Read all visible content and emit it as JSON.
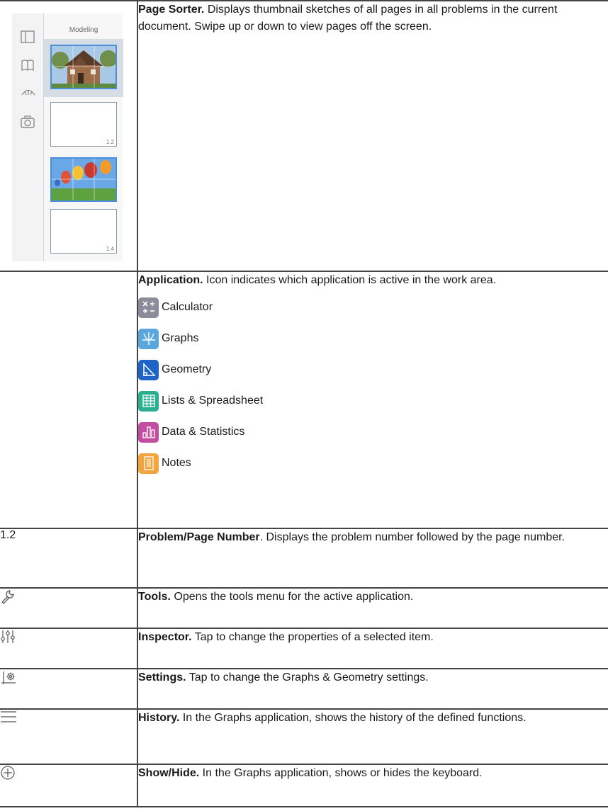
{
  "sorter": {
    "title": "Modeling",
    "thumbnails": [
      {
        "page": "",
        "content": "house"
      },
      {
        "page": "1.2",
        "content": "blank"
      },
      {
        "page": "",
        "content": "balloons"
      },
      {
        "page": "1.4",
        "content": "blank"
      }
    ],
    "side_icons": [
      "page-sorter-icon",
      "book-icon",
      "scale-icon",
      "camera-icon"
    ]
  },
  "rows": {
    "page_sorter": {
      "term": "Page Sorter.",
      "text": " Displays thumbnail sketches of all pages in all problems in the current document. Swipe up or down to view pages off the screen."
    },
    "application": {
      "term": "Application.",
      "text": " Icon indicates which application is active in the work area."
    },
    "problem_page": {
      "left": "1.2",
      "term": "Problem/Page Number",
      "text": ". Displays the problem number followed by the page number."
    },
    "tools": {
      "term": "Tools.",
      "text": " Opens the tools menu for the active application."
    },
    "inspector": {
      "term": "Inspector.",
      "text": " Tap to change the properties of a selected item."
    },
    "settings": {
      "term": "Settings.",
      "text": " Tap to change the Graphs & Geometry settings."
    },
    "history": {
      "term": "History.",
      "text": " In the Graphs application, shows the history of the defined functions."
    },
    "show_hide": {
      "term": "Show/Hide.",
      "text": " In the Graphs application, shows or hides the keyboard."
    }
  },
  "apps": [
    {
      "label": "Calculator",
      "icon": "calculator-icon",
      "color": "#8a8d99"
    },
    {
      "label": "Graphs",
      "icon": "graphs-icon",
      "color": "#5aa6dd"
    },
    {
      "label": "Geometry",
      "icon": "geometry-icon",
      "color": "#1e63c6"
    },
    {
      "label": "Lists & Spreadsheet",
      "icon": "spreadsheet-icon",
      "color": "#2bb08f"
    },
    {
      "label": "Data & Statistics",
      "icon": "data-statistics-icon",
      "color": "#c14ea0"
    },
    {
      "label": "Notes",
      "icon": "notes-icon",
      "color": "#f2a53f"
    }
  ]
}
